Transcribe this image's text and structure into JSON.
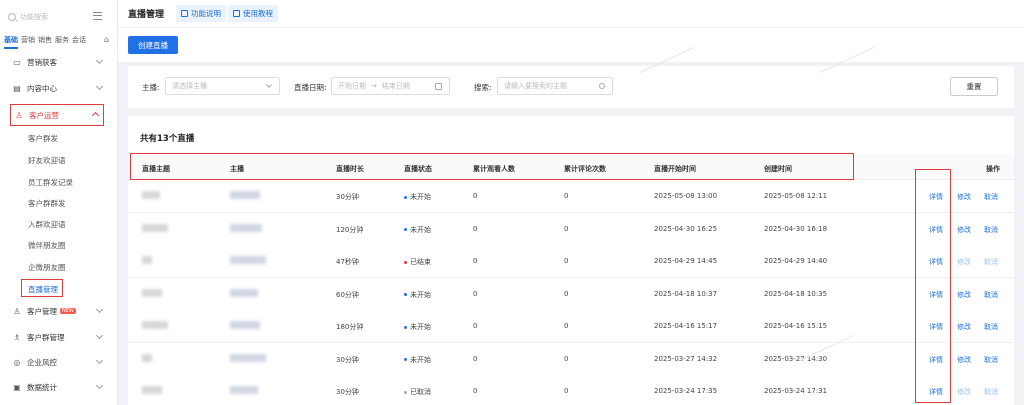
{
  "sidebar": {
    "search_placeholder": "功能搜索",
    "categories": [
      "基础",
      "营销",
      "销售",
      "服务",
      "会话"
    ],
    "menu": [
      {
        "label": "营销获客",
        "icon": "megaphone-icon"
      },
      {
        "label": "内容中心",
        "icon": "document-icon"
      },
      {
        "label": "客户运营",
        "icon": "user-icon"
      },
      {
        "label": "客户管理",
        "icon": "users-icon",
        "badge": "NEW"
      },
      {
        "label": "客户群管理",
        "icon": "group-icon"
      },
      {
        "label": "企业风控",
        "icon": "shield-icon"
      },
      {
        "label": "数据统计",
        "icon": "chart-icon"
      }
    ],
    "sub_items": [
      "客户群发",
      "好友欢迎语",
      "员工群发记录",
      "客户群群发",
      "入群欢迎语",
      "微伴朋友圈",
      "企微朋友圈",
      "直播管理"
    ]
  },
  "header": {
    "title": "直播管理",
    "link1": "功能说明",
    "link2": "使用教程"
  },
  "toolbar": {
    "create_label": "创建直播"
  },
  "filter": {
    "anchor_label": "主播:",
    "anchor_placeholder": "请选择主播",
    "date_label": "直播日期:",
    "date_start": "开始日期",
    "date_arrow": "→",
    "date_end": "结束日期",
    "search_label": "搜索:",
    "search_placeholder": "请输入要搜索的主题",
    "reset_label": "重置"
  },
  "table": {
    "count_text": "共有13个直播",
    "headers": [
      "直播主题",
      "主播",
      "直播时长",
      "直播状态",
      "累计观看人数",
      "累计评论次数",
      "直播开始时间",
      "创建时间",
      "操作"
    ],
    "rows": [
      {
        "duration": "30分钟",
        "status": "未开始",
        "status_color": "#2070e6",
        "viewers": "0",
        "comments": "0",
        "start": "2025-05-08 13:00",
        "created": "2025-05-08 12:11",
        "edit_disabled": false
      },
      {
        "duration": "120分钟",
        "status": "未开始",
        "status_color": "#2070e6",
        "viewers": "0",
        "comments": "0",
        "start": "2025-04-30 16:25",
        "created": "2025-04-30 16:18",
        "edit_disabled": false
      },
      {
        "duration": "47秒钟",
        "status": "已结束",
        "status_color": "#e23b3b",
        "viewers": "0",
        "comments": "0",
        "start": "2025-04-29 14:45",
        "created": "2025-04-29 14:40",
        "edit_disabled": true
      },
      {
        "duration": "60分钟",
        "status": "未开始",
        "status_color": "#2070e6",
        "viewers": "0",
        "comments": "0",
        "start": "2025-04-18 10:37",
        "created": "2025-04-18 10:35",
        "edit_disabled": false
      },
      {
        "duration": "180分钟",
        "status": "未开始",
        "status_color": "#2070e6",
        "viewers": "0",
        "comments": "0",
        "start": "2025-04-16 15:17",
        "created": "2025-04-16 15:15",
        "edit_disabled": false
      },
      {
        "duration": "30分钟",
        "status": "未开始",
        "status_color": "#2070e6",
        "viewers": "0",
        "comments": "0",
        "start": "2025-03-27 14:32",
        "created": "2025-03-27 14:30",
        "edit_disabled": false
      },
      {
        "duration": "30分钟",
        "status": "已取消",
        "status_color": "#aaaaaa",
        "viewers": "0",
        "comments": "0",
        "start": "2025-03-24 17:35",
        "created": "2025-03-24 17:31",
        "edit_disabled": true
      }
    ],
    "actions": {
      "detail": "详情",
      "edit": "修改",
      "cancel": "取消"
    }
  },
  "colors": {
    "accent": "#2070e6",
    "highlight": "#e23b3b"
  }
}
